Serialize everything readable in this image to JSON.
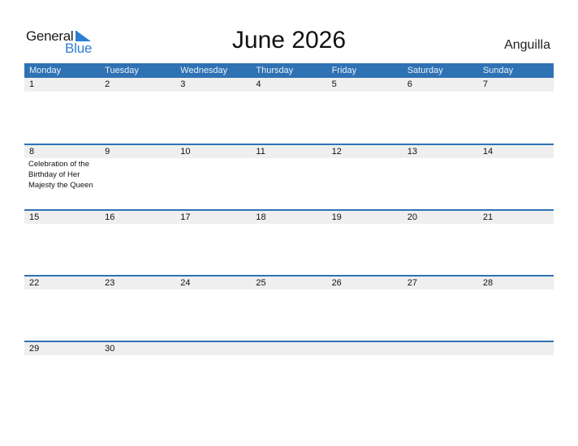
{
  "logo": {
    "line1": "General",
    "line2": "Blue"
  },
  "title": "June 2026",
  "country": "Anguilla",
  "colors": {
    "accent": "#2f72b4",
    "logo_blue": "#2e7dd1",
    "day_row_bg": "#efefef"
  },
  "weekdays": [
    "Monday",
    "Tuesday",
    "Wednesday",
    "Thursday",
    "Friday",
    "Saturday",
    "Sunday"
  ],
  "weeks": [
    {
      "days": [
        "1",
        "2",
        "3",
        "4",
        "5",
        "6",
        "7"
      ],
      "events": [
        "",
        "",
        "",
        "",
        "",
        "",
        ""
      ]
    },
    {
      "days": [
        "8",
        "9",
        "10",
        "11",
        "12",
        "13",
        "14"
      ],
      "events": [
        "Celebration of the Birthday of Her Majesty the Queen",
        "",
        "",
        "",
        "",
        "",
        ""
      ]
    },
    {
      "days": [
        "15",
        "16",
        "17",
        "18",
        "19",
        "20",
        "21"
      ],
      "events": [
        "",
        "",
        "",
        "",
        "",
        "",
        ""
      ]
    },
    {
      "days": [
        "22",
        "23",
        "24",
        "25",
        "26",
        "27",
        "28"
      ],
      "events": [
        "",
        "",
        "",
        "",
        "",
        "",
        ""
      ]
    },
    {
      "days": [
        "29",
        "30",
        "",
        "",
        "",
        "",
        ""
      ],
      "events": [
        "",
        "",
        "",
        "",
        "",
        "",
        ""
      ]
    }
  ]
}
